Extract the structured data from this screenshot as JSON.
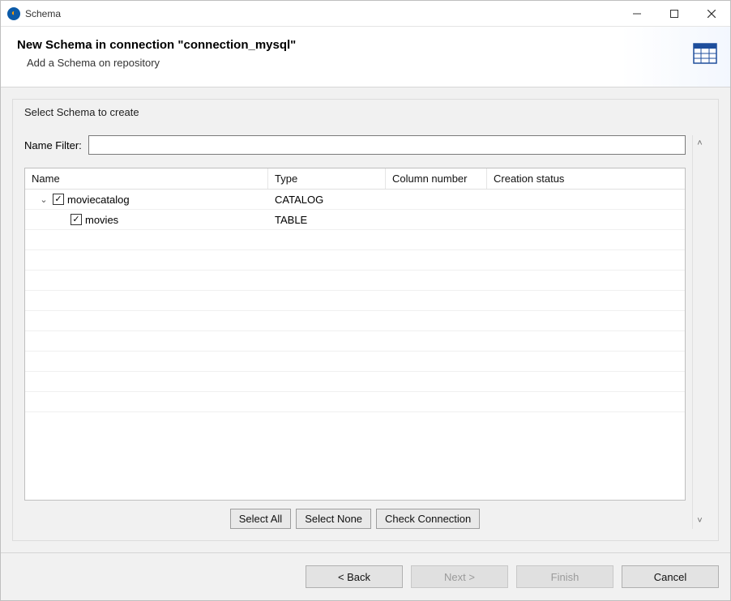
{
  "window": {
    "title": "Schema"
  },
  "header": {
    "title": "New Schema in connection \"connection_mysql\"",
    "subtitle": "Add a Schema on repository"
  },
  "group": {
    "legend": "Select Schema to create",
    "filter_label": "Name Filter:",
    "filter_value": ""
  },
  "table": {
    "columns": {
      "name": "Name",
      "type": "Type",
      "column_number": "Column number",
      "creation_status": "Creation status"
    },
    "rows": [
      {
        "indent": 0,
        "expandable": true,
        "expanded": true,
        "checked": true,
        "name": "moviecatalog",
        "type": "CATALOG",
        "column_number": "",
        "creation_status": ""
      },
      {
        "indent": 1,
        "expandable": false,
        "expanded": false,
        "checked": true,
        "name": "movies",
        "type": "TABLE",
        "column_number": "",
        "creation_status": ""
      }
    ]
  },
  "buttons": {
    "select_all": "Select All",
    "select_none": "Select None",
    "check_conn": "Check Connection"
  },
  "wizard": {
    "back": "< Back",
    "next": "Next >",
    "finish": "Finish",
    "cancel": "Cancel"
  }
}
